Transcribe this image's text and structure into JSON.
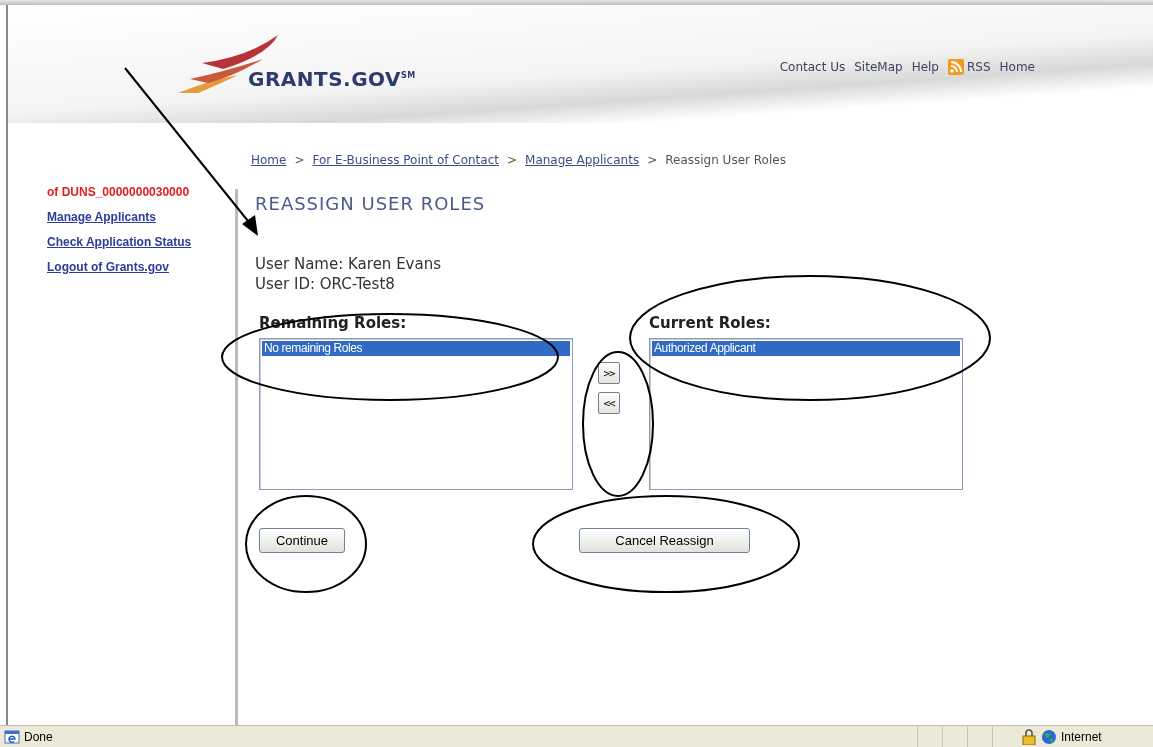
{
  "header": {
    "logo": "GRANTS.GOV$^{SM}$",
    "links": [
      {
        "label": "Contact Us",
        "kind": "text"
      },
      {
        "label": "SiteMap",
        "kind": "text"
      },
      {
        "label": "Help",
        "kind": "text"
      },
      {
        "label": "RSS",
        "kind": "rss"
      },
      {
        "label": "Home",
        "kind": "text"
      }
    ]
  },
  "breadcrumb": [
    {
      "label": "Home",
      "kind": "link"
    },
    {
      "label": ">",
      "kind": "separator"
    },
    {
      "label": "For E-Business Point of Contact",
      "kind": "link"
    },
    {
      "label": ">",
      "kind": "separator"
    },
    {
      "label": "Manage Applicants",
      "kind": "link"
    },
    {
      "label": ">",
      "kind": "separator"
    },
    {
      "label": "Reassign User Roles",
      "kind": "current"
    }
  ],
  "sidebar": {
    "notice": "of DUNS_0000000030000",
    "items": [
      {
        "label": "Manage Applicants"
      },
      {
        "label": "Check Application Status"
      },
      {
        "label": "Logout of Grants.gov"
      }
    ]
  },
  "title": "REASSIGN USER ROLES",
  "user_name": "User Name: Karen Evans",
  "user_id": "User ID: ORC-Test8",
  "remaining_roles": {
    "label": "Remaining Roles:",
    "options": [
      {
        "label": "No remaining Roles",
        "selected": true
      }
    ]
  },
  "move_buttons": [
    ">>",
    "<<"
  ],
  "current_roles": {
    "label": "Current Roles:",
    "options": [
      {
        "label": "Authorized Applicant",
        "selected": true
      }
    ]
  },
  "buttons": [
    {
      "label": "Continue",
      "kind": "continue"
    },
    {
      "label": "Cancel Reassign",
      "kind": "cancel"
    }
  ],
  "status_bar": {
    "text": "Done",
    "zone": "Internet"
  }
}
